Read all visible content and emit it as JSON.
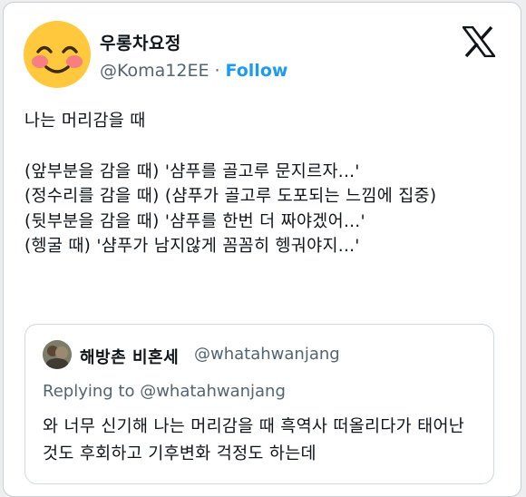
{
  "author": {
    "display_name": "우롱차요정",
    "handle": "@Koma12EE",
    "separator": "·",
    "follow_label": "Follow"
  },
  "platform": {
    "logo_icon": "x-logo-icon"
  },
  "tweet": {
    "line1": "나는 머리감을 때",
    "line2": "(앞부분을 감을 때) '샴푸를 골고루 문지르자...'",
    "line3": "(정수리를 감을 때) (샴푸가 골고루 도포되는 느낌에 집중)",
    "line4": "(뒷부분을 감을 때) '샴푸를 한번 더 짜야겠어...'",
    "line5": "(헹굴 때) '샴푸가 남지않게 꼼꼼히 헹궈야지...'"
  },
  "quoted_tweet": {
    "display_name": "해방촌 비혼세",
    "handle": "@whatahwanjang",
    "replying_to": "Replying to @whatahwanjang",
    "body": "와 너무 신기해 나는 머리감을 때 흑역사 떠올리다가 태어난 것도 후회하고 기후변화 걱정도 하는데"
  },
  "colors": {
    "accent": "#1d9bf0",
    "secondary_text": "#536471",
    "avatar_face": "#ffc83d",
    "avatar_cheeks": "#f7718d"
  }
}
